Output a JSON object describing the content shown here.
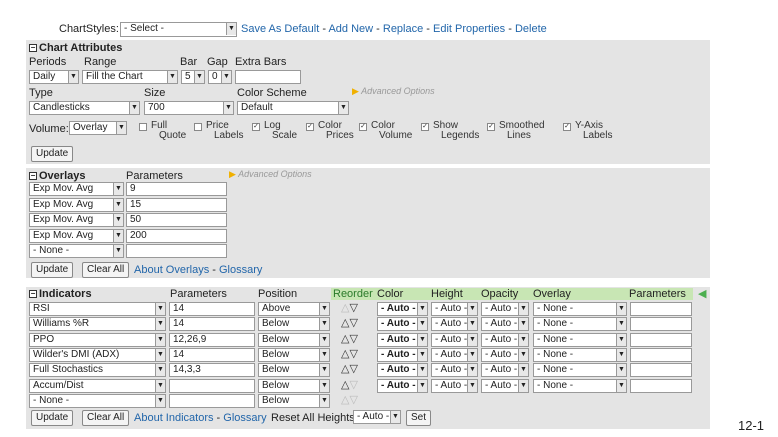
{
  "top": {
    "label": "ChartStyles:",
    "select_value": "- Select -",
    "links": [
      "Save As Default",
      "Add New",
      "Replace",
      "Edit Properties",
      "Delete"
    ]
  },
  "chart_attributes": {
    "title": "Chart Attributes",
    "labels": {
      "periods": "Periods",
      "range": "Range",
      "bar": "Bar",
      "gap": "Gap",
      "extra_bars": "Extra Bars",
      "type": "Type",
      "size": "Size",
      "color_scheme": "Color Scheme",
      "volume": "Volume:"
    },
    "periods_value": "Daily",
    "range_value": "Fill the Chart",
    "bar_value": "5",
    "gap_value": "0",
    "extra_bars_value": "",
    "type_value": "Candlesticks",
    "size_value": "700",
    "color_scheme_value": "Default",
    "advanced_options": "Advanced Options",
    "volume_value": "Overlay",
    "checkboxes": [
      {
        "l1": "Full",
        "l2": "Quote",
        "checked": false
      },
      {
        "l1": "Price",
        "l2": "Labels",
        "checked": false
      },
      {
        "l1": "Log",
        "l2": "Scale",
        "checked": true
      },
      {
        "l1": "Color",
        "l2": "Prices",
        "checked": true
      },
      {
        "l1": "Color",
        "l2": "Volume",
        "checked": true
      },
      {
        "l1": "Show",
        "l2": "Legends",
        "checked": true
      },
      {
        "l1": "Smoothed",
        "l2": "Lines",
        "checked": true
      },
      {
        "l1": "Y-Axis",
        "l2": "Labels",
        "checked": true
      }
    ],
    "update": "Update"
  },
  "overlays": {
    "title": "Overlays",
    "parameters_label": "Parameters",
    "advanced_options": "Advanced Options",
    "rows": [
      {
        "name": "Exp Mov. Avg",
        "param": "9"
      },
      {
        "name": "Exp Mov. Avg",
        "param": "15"
      },
      {
        "name": "Exp Mov. Avg",
        "param": "50"
      },
      {
        "name": "Exp Mov. Avg",
        "param": "200"
      },
      {
        "name": "- None -",
        "param": ""
      }
    ],
    "update": "Update",
    "clear_all": "Clear All",
    "about": "About Overlays",
    "glossary": "Glossary"
  },
  "indicators": {
    "title": "Indicators",
    "columns": {
      "parameters": "Parameters",
      "position": "Position",
      "reorder": "Reorder",
      "color": "Color",
      "height": "Height",
      "opacity": "Opacity",
      "overlay": "Overlay",
      "parameters2": "Parameters"
    },
    "rows": [
      {
        "name": "RSI",
        "param": "14",
        "position": "Above",
        "color": "- Auto -",
        "height": "- Auto -",
        "opacity": "- Auto -",
        "overlay": "- None -",
        "up": false,
        "down": true
      },
      {
        "name": "Williams %R",
        "param": "14",
        "position": "Below",
        "color": "- Auto -",
        "height": "- Auto -",
        "opacity": "- Auto -",
        "overlay": "- None -",
        "up": true,
        "down": true
      },
      {
        "name": "PPO",
        "param": "12,26,9",
        "position": "Below",
        "color": "- Auto -",
        "height": "- Auto -",
        "opacity": "- Auto -",
        "overlay": "- None -",
        "up": true,
        "down": true
      },
      {
        "name": "Wilder's DMI (ADX)",
        "param": "14",
        "position": "Below",
        "color": "- Auto -",
        "height": "- Auto -",
        "opacity": "- Auto -",
        "overlay": "- None -",
        "up": true,
        "down": true
      },
      {
        "name": "Full Stochastics",
        "param": "14,3,3",
        "position": "Below",
        "color": "- Auto -",
        "height": "- Auto -",
        "opacity": "- Auto -",
        "overlay": "- None -",
        "up": true,
        "down": true
      },
      {
        "name": "Accum/Dist",
        "param": "",
        "position": "Below",
        "color": "- Auto -",
        "height": "- Auto -",
        "opacity": "- Auto -",
        "overlay": "- None -",
        "up": true,
        "down": false
      },
      {
        "name": "- None -",
        "param": "",
        "position": "Below",
        "color": "",
        "height": "",
        "opacity": "",
        "overlay": "",
        "up": false,
        "down": false
      }
    ],
    "update": "Update",
    "clear_all": "Clear All",
    "about": "About Indicators",
    "glossary": "Glossary",
    "reset_label": "Reset All Heights:",
    "reset_value": "- Auto -",
    "set": "Set"
  },
  "page_number": "12-1",
  "colors": {
    "panel": "#e4e4e4",
    "header_green": "#c8e6b4",
    "link": "#2266aa",
    "arrow_green": "#4caf50"
  }
}
